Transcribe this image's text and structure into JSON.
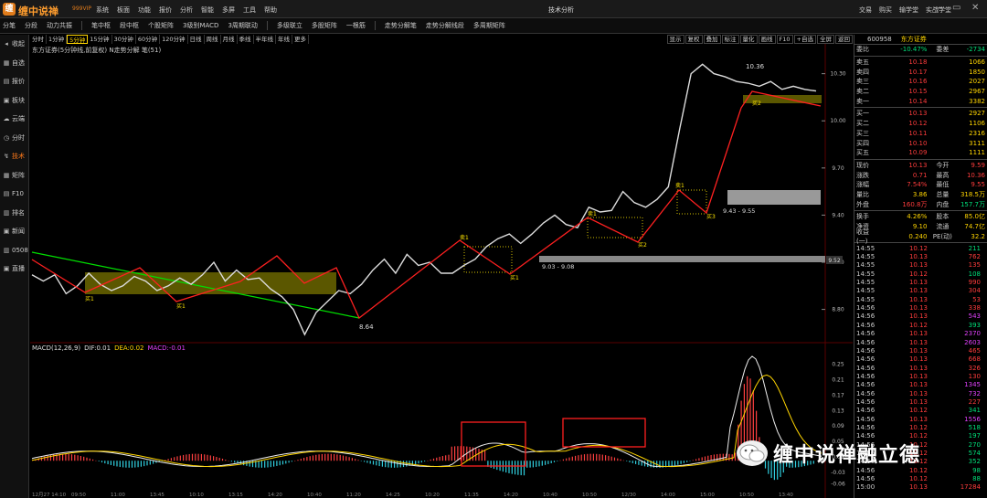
{
  "app": {
    "logo_char": "缠",
    "name": "缠中说禅",
    "version": "999VIP",
    "window_title": "技术分析",
    "menu": [
      "系统",
      "板面",
      "功能",
      "报价",
      "分析",
      "智能",
      "多屏",
      "工具",
      "帮助"
    ],
    "right_menu": [
      "交易",
      "购买",
      "输学堂",
      "实战学堂"
    ],
    "controls": [
      "—",
      "▭",
      "✕"
    ]
  },
  "toolbar": {
    "items": [
      "分笔",
      "分段",
      "动力共振",
      "笔中枢",
      "段中枢",
      "个股矩阵",
      "3级别MACD",
      "3周期联动",
      "多级联立",
      "多股矩阵",
      "一根筋",
      "走势分解笔",
      "走势分解线段",
      "多周期矩阵"
    ]
  },
  "sidebar": {
    "items": [
      {
        "icon": "◂",
        "label": "收起"
      },
      {
        "icon": "▦",
        "label": "自选"
      },
      {
        "icon": "▤",
        "label": "报价"
      },
      {
        "icon": "▣",
        "label": "板块"
      },
      {
        "icon": "☁",
        "label": "云端"
      },
      {
        "icon": "◷",
        "label": "分时"
      },
      {
        "icon": "↯",
        "label": "技术"
      },
      {
        "icon": "▦",
        "label": "矩阵"
      },
      {
        "icon": "▤",
        "label": "F10"
      },
      {
        "icon": "▥",
        "label": "排名"
      },
      {
        "icon": "▣",
        "label": "新闻"
      },
      {
        "icon": "▥",
        "label": "0508"
      },
      {
        "icon": "▣",
        "label": "直播"
      }
    ],
    "active": 6
  },
  "periods": [
    "分时",
    "1分钟",
    "5分钟",
    "15分钟",
    "30分钟",
    "60分钟",
    "120分钟",
    "日线",
    "周线",
    "月线",
    "季线",
    "半年线",
    "年线",
    "更多"
  ],
  "period_selected": 2,
  "chart_tools": [
    "显示",
    "复权",
    "叠加",
    "标注",
    "量化",
    "画线",
    "F10",
    "+自选",
    "全屏",
    "返回"
  ],
  "chart_caption": "东方证券(5分钟线,前复权)  N走势分解 笔(51)",
  "macd": {
    "label": "MACD(12,26,9)",
    "dif": "DIF:0.01",
    "dea": "DEA:0.02",
    "macd": "MACD:-0.01"
  },
  "price_axis": [
    "10.30",
    "10.00",
    "9.70",
    "9.40",
    "9.10",
    "8.80"
  ],
  "macd_axis": [
    "0.25",
    "0.21",
    "0.17",
    "0.13",
    "0.09",
    "0.05",
    "0.01",
    "-0.03",
    "-0.06"
  ],
  "current_price_tag": "9.52",
  "time_labels": [
    "12月27 14:10",
    "09:50",
    "11:00",
    "13:45",
    "10:10",
    "13:15",
    "14:20",
    "10:40",
    "11:20",
    "14:25",
    "10:20",
    "11:35",
    "14:20",
    "10:40",
    "10:50",
    "12/30",
    "14:00",
    "15:00",
    "10:50",
    "13:40"
  ],
  "annotations": {
    "high": "10.36",
    "low": "8.64",
    "zone1": "9.03 - 9.08",
    "zone2": "9.43 - 9.55",
    "buy_labels": [
      "买1",
      "买2",
      "买3"
    ],
    "sell_labels": [
      "卖1",
      "卖2",
      "卖3"
    ],
    "stroke_label": "笔"
  },
  "chart_data": {
    "type": "line",
    "title": "东方证券(5分钟线,前复权)",
    "ylim": [
      8.6,
      10.42
    ],
    "price_path": [
      9.02,
      8.98,
      9.02,
      8.9,
      8.95,
      9.03,
      8.96,
      8.92,
      8.95,
      9.01,
      8.98,
      8.92,
      8.95,
      9.0,
      8.96,
      9.02,
      9.1,
      8.98,
      9.05,
      8.99,
      9.0,
      8.93,
      8.88,
      8.8,
      8.64,
      8.78,
      8.85,
      8.92,
      8.9,
      8.96,
      9.05,
      9.12,
      9.03,
      9.15,
      9.08,
      9.1,
      9.03,
      9.03,
      9.08,
      9.12,
      9.2,
      9.25,
      9.28,
      9.22,
      9.28,
      9.35,
      9.4,
      9.34,
      9.32,
      9.45,
      9.42,
      9.43,
      9.55,
      9.48,
      9.45,
      9.5,
      9.58,
      9.95,
      10.3,
      10.36,
      10.3,
      10.28,
      10.25,
      10.24,
      10.22,
      10.25,
      10.2,
      10.22,
      10.2,
      10.19
    ]
  },
  "quote": {
    "code": "600958",
    "name": "东方证券",
    "ratio": {
      "label": "委比",
      "value": "-10.47%",
      "label2": "委差",
      "value2": "-2734"
    },
    "asks": [
      {
        "label": "卖五",
        "price": "10.18",
        "vol": "1066"
      },
      {
        "label": "卖四",
        "price": "10.17",
        "vol": "1850"
      },
      {
        "label": "卖三",
        "price": "10.16",
        "vol": "2027"
      },
      {
        "label": "卖二",
        "price": "10.15",
        "vol": "2967"
      },
      {
        "label": "卖一",
        "price": "10.14",
        "vol": "3382"
      }
    ],
    "bids": [
      {
        "label": "买一",
        "price": "10.13",
        "vol": "2927"
      },
      {
        "label": "买二",
        "price": "10.12",
        "vol": "1106"
      },
      {
        "label": "买三",
        "price": "10.11",
        "vol": "2316"
      },
      {
        "label": "买四",
        "price": "10.10",
        "vol": "3111"
      },
      {
        "label": "买五",
        "price": "10.09",
        "vol": "1111"
      }
    ],
    "stats": [
      {
        "l1": "现价",
        "v1": "10.13",
        "l2": "今开",
        "v2": "9.59",
        "c1": "red",
        "c2": "red"
      },
      {
        "l1": "涨跌",
        "v1": "0.71",
        "l2": "最高",
        "v2": "10.36",
        "c1": "red",
        "c2": "red"
      },
      {
        "l1": "涨幅",
        "v1": "7.54%",
        "l2": "最低",
        "v2": "9.55",
        "c1": "red",
        "c2": "red"
      },
      {
        "l1": "量比",
        "v1": "3.86",
        "l2": "总量",
        "v2": "318.5万",
        "c1": "yellow",
        "c2": "yellow"
      },
      {
        "l1": "外盘",
        "v1": "160.8万",
        "l2": "内盘",
        "v2": "157.7万",
        "c1": "red",
        "c2": "green"
      }
    ],
    "stats2": [
      {
        "l1": "换手",
        "v1": "4.26%",
        "l2": "股本",
        "v2": "85.0亿"
      },
      {
        "l1": "净资",
        "v1": "9.10",
        "l2": "流通",
        "v2": "74.7亿"
      },
      {
        "l1": "收益(一)",
        "v1": "0.240",
        "l2": "PE(动)",
        "v2": "32.2"
      }
    ],
    "ticks": [
      {
        "t": "14:55",
        "p": "10.12",
        "v": "211",
        "vc": "green"
      },
      {
        "t": "14:55",
        "p": "10.13",
        "v": "762",
        "vc": "red"
      },
      {
        "t": "14:55",
        "p": "10.13",
        "v": "135",
        "vc": "red"
      },
      {
        "t": "14:55",
        "p": "10.12",
        "v": "108",
        "vc": "green"
      },
      {
        "t": "14:55",
        "p": "10.13",
        "v": "990",
        "vc": "red"
      },
      {
        "t": "14:55",
        "p": "10.13",
        "v": "304",
        "vc": "red"
      },
      {
        "t": "14:55",
        "p": "10.13",
        "v": "53",
        "vc": "red"
      },
      {
        "t": "14:56",
        "p": "10.13",
        "v": "338",
        "vc": "red"
      },
      {
        "t": "14:56",
        "p": "10.13",
        "v": "543",
        "vc": "magenta"
      },
      {
        "t": "14:56",
        "p": "10.12",
        "v": "393",
        "vc": "green"
      },
      {
        "t": "14:56",
        "p": "10.13",
        "v": "2370",
        "vc": "magenta"
      },
      {
        "t": "14:56",
        "p": "10.13",
        "v": "2603",
        "vc": "magenta"
      },
      {
        "t": "14:56",
        "p": "10.13",
        "v": "465",
        "vc": "red"
      },
      {
        "t": "14:56",
        "p": "10.13",
        "v": "668",
        "vc": "red"
      },
      {
        "t": "14:56",
        "p": "10.13",
        "v": "326",
        "vc": "red"
      },
      {
        "t": "14:56",
        "p": "10.13",
        "v": "130",
        "vc": "red"
      },
      {
        "t": "14:56",
        "p": "10.13",
        "v": "1345",
        "vc": "magenta"
      },
      {
        "t": "14:56",
        "p": "10.13",
        "v": "732",
        "vc": "magenta"
      },
      {
        "t": "14:56",
        "p": "10.13",
        "v": "227",
        "vc": "red"
      },
      {
        "t": "14:56",
        "p": "10.12",
        "v": "341",
        "vc": "green"
      },
      {
        "t": "14:56",
        "p": "10.13",
        "v": "1556",
        "vc": "magenta"
      },
      {
        "t": "14:56",
        "p": "10.12",
        "v": "518",
        "vc": "green"
      },
      {
        "t": "14:56",
        "p": "10.12",
        "v": "197",
        "vc": "green"
      },
      {
        "t": "14:56",
        "p": "10.12",
        "v": "270",
        "vc": "green"
      },
      {
        "t": "14:56",
        "p": "10.12",
        "v": "574",
        "vc": "green"
      },
      {
        "t": "14:56",
        "p": "10.12",
        "v": "352",
        "vc": "green"
      },
      {
        "t": "14:56",
        "p": "10.12",
        "v": "98",
        "vc": "green"
      },
      {
        "t": "14:56",
        "p": "10.12",
        "v": "88",
        "vc": "green"
      },
      {
        "t": "15:00",
        "p": "10.13",
        "v": "17284",
        "vc": "red"
      }
    ]
  },
  "watermark": {
    "text": "缠中说禅融立德"
  }
}
